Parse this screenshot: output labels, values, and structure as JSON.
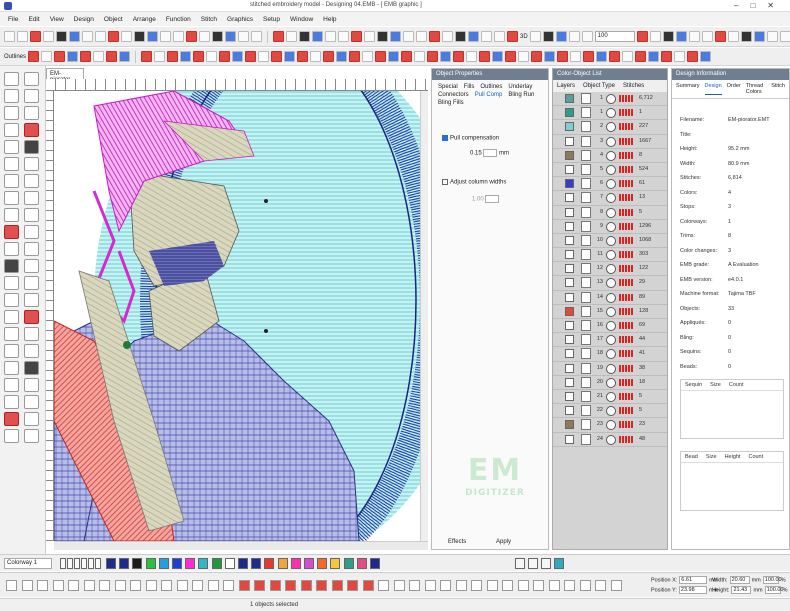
{
  "window": {
    "title": "stitched embroidery model - Designing 04.EMB - [ EMB graphic ]",
    "controls": [
      "–",
      "□",
      "✕"
    ]
  },
  "menu": [
    "File",
    "Edit",
    "View",
    "Design",
    "Object",
    "Arrange",
    "Function",
    "Stitch",
    "Graphics",
    "Setup",
    "Window",
    "Help"
  ],
  "toolbar": {
    "outlines_label": "Outlines",
    "zoom_value": "100",
    "tb_3d": "3D"
  },
  "design_tab": "EM-piorator",
  "object_properties": {
    "title": "Object Properties",
    "tabs": [
      "Special",
      "Fills",
      "Outlines",
      "Underlay",
      "Connectors",
      "Pull Comp",
      "Bling Run",
      "Bling Fills"
    ],
    "active_tab": "Pull Comp",
    "pull_comp_label": "Pull compensation",
    "pull_comp_value": "0.15",
    "pull_comp_unit": "mm",
    "adjust_label": "Adjust column widths",
    "adjust_value": "1.00",
    "effects_label": "Effects",
    "apply_label": "Apply"
  },
  "color_object_list": {
    "title": "Color-Object List",
    "tabs": [
      "Layers",
      "Object Type",
      "Stitches"
    ],
    "rows": [
      {
        "n": "1",
        "st": "6,712"
      },
      {
        "n": "1",
        "st": "1"
      },
      {
        "n": "2",
        "st": "227"
      },
      {
        "n": "3",
        "st": "1667"
      },
      {
        "n": "4",
        "st": "8"
      },
      {
        "n": "5",
        "st": "524"
      },
      {
        "n": "6",
        "st": "61"
      },
      {
        "n": "7",
        "st": "13"
      },
      {
        "n": "8",
        "st": "5"
      },
      {
        "n": "9",
        "st": "1296"
      },
      {
        "n": "10",
        "st": "1068"
      },
      {
        "n": "11",
        "st": "303"
      },
      {
        "n": "12",
        "st": "122"
      },
      {
        "n": "13",
        "st": "29"
      },
      {
        "n": "14",
        "st": "89"
      },
      {
        "n": "15",
        "st": "128"
      },
      {
        "n": "16",
        "st": "69"
      },
      {
        "n": "17",
        "st": "44"
      },
      {
        "n": "18",
        "st": "41"
      },
      {
        "n": "19",
        "st": "38"
      },
      {
        "n": "20",
        "st": "18"
      },
      {
        "n": "21",
        "st": "5"
      },
      {
        "n": "22",
        "st": "5"
      },
      {
        "n": "23",
        "st": "23"
      },
      {
        "n": "24",
        "st": "48"
      }
    ],
    "swatch_colors": [
      "#5aa0a0",
      "#2e9e8c",
      "#7fd0d0",
      "#ffffff",
      "#8c7a5a",
      "#ffffff",
      "#3a3ad0",
      "#ffffff",
      "#ffffff",
      "#ffffff",
      "#ffffff",
      "#ffffff",
      "#ffffff",
      "#ffffff",
      "#ffffff",
      "#e04a3a",
      "#ffffff",
      "#ffffff",
      "#ffffff",
      "#ffffff",
      "#ffffff",
      "#ffffff",
      "#ffffff",
      "#8c7a5a",
      "#ffffff"
    ]
  },
  "design_info": {
    "title": "Design Information",
    "tabs": [
      "Summary",
      "Design",
      "Order",
      "Thread Colors",
      "Stitch"
    ],
    "active_tab": "Design",
    "rows": [
      {
        "label": "Filename:",
        "value": "EM-piorator.EMT"
      },
      {
        "label": "Title:",
        "value": ""
      },
      {
        "label": "Height:",
        "value": "95.2 mm"
      },
      {
        "label": "Width:",
        "value": "80.9 mm"
      },
      {
        "label": "Stitches:",
        "value": "6,814"
      },
      {
        "label": "Colors:",
        "value": "4"
      },
      {
        "label": "Stops:",
        "value": "3"
      },
      {
        "label": "Colorways:",
        "value": "1"
      },
      {
        "label": "Trims:",
        "value": "8"
      },
      {
        "label": "Color changes:",
        "value": "3"
      },
      {
        "label": "EMB grade:",
        "value": "A  Evaluation"
      },
      {
        "label": "EMB version:",
        "value": "e4.0.1"
      },
      {
        "label": "Machine format:",
        "value": "Tajima TBF"
      },
      {
        "label": "Objects:",
        "value": "33"
      },
      {
        "label": "Appliqués:",
        "value": "0"
      },
      {
        "label": "Bling:",
        "value": "0"
      },
      {
        "label": "Sequins:",
        "value": "0"
      },
      {
        "label": "Beads:",
        "value": "0"
      }
    ],
    "table1_headers": [
      "Sequin",
      "Size",
      "Count"
    ],
    "table2_headers": [
      "Bead",
      "Size",
      "Height",
      "Count"
    ]
  },
  "colorbar": {
    "colorway_label": "Colorway 1",
    "colors": [
      "#1e2a8c",
      "#1e2a8c",
      "#1b1b1b",
      "#25c33c",
      "#21a0e0",
      "#1d3fd6",
      "#ff2bd0",
      "#2fb7c4",
      "#1f9a3a",
      "#ffffff",
      "#1e2a8c",
      "#1e2a8c",
      "#e8392f",
      "#f0a63a",
      "#ff2fb0",
      "#d94ad4",
      "#f06a2a",
      "#f4c63a",
      "#2e9e8c",
      "#e34b8a",
      "#1e2a8c"
    ]
  },
  "position": {
    "x_label": "Position X:",
    "x_value": "6.61",
    "y_label": "Position Y:",
    "y_value": "23.98",
    "w_label": "Width:",
    "w_value": "20.60",
    "h_label": "Height:",
    "h_value": "21.43",
    "unit": "mm",
    "pct_w": "100.00",
    "pct_h": "100.00",
    "pct": "%"
  },
  "status": "1 objects selected",
  "watermark": {
    "big": "EM",
    "small": "DIGITIZER"
  }
}
